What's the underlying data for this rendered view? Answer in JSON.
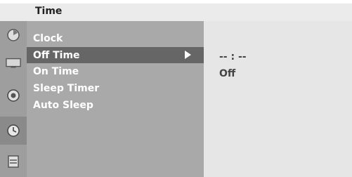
{
  "title": "Time",
  "sidebar": {
    "icons": [
      {
        "name": "picture-icon"
      },
      {
        "name": "screen-icon"
      },
      {
        "name": "audio-icon"
      },
      {
        "name": "time-icon",
        "active": true
      },
      {
        "name": "special-icon"
      }
    ]
  },
  "menu": {
    "items": [
      {
        "label": "Clock"
      },
      {
        "label": "Off Time",
        "selected": true
      },
      {
        "label": "On Time"
      },
      {
        "label": "Sleep Timer"
      },
      {
        "label": "Auto Sleep"
      }
    ]
  },
  "detail": {
    "time_value": "-- : --",
    "state_value": "Off"
  }
}
